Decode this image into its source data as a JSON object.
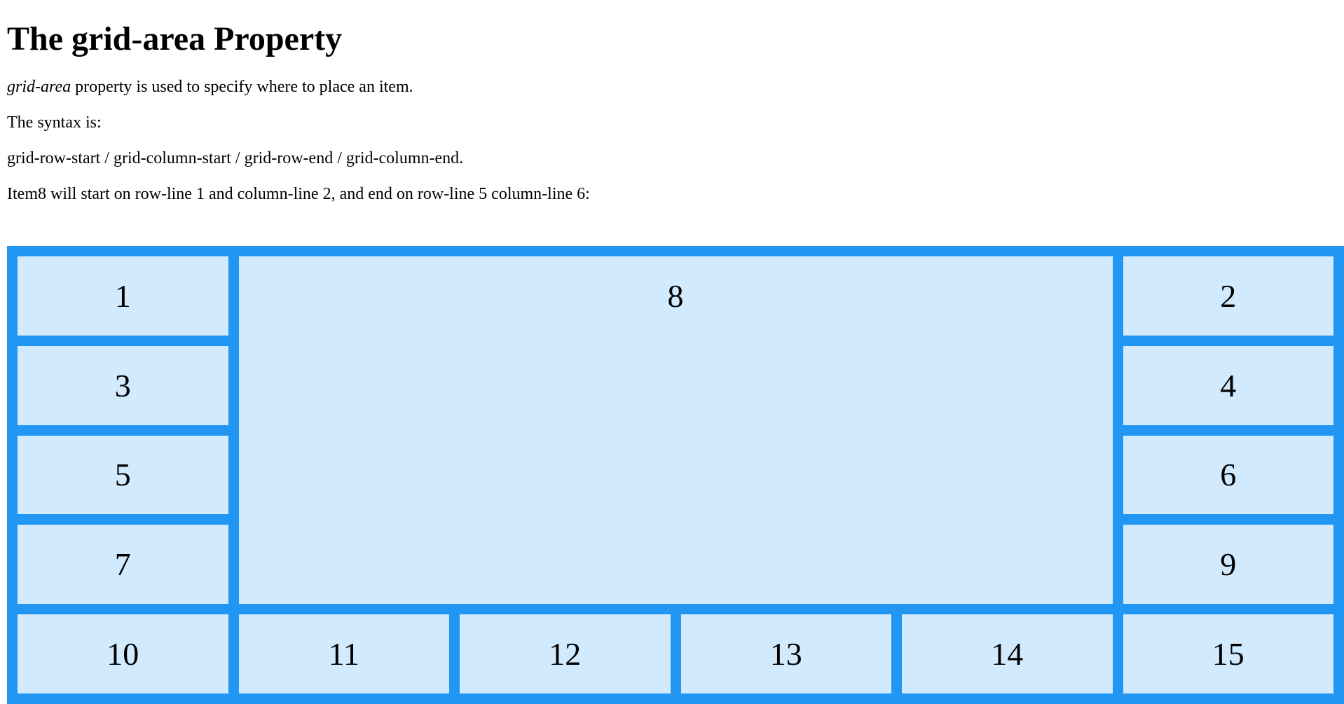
{
  "heading": "The grid-area Property",
  "paragraphs": {
    "intro_em": "grid-area",
    "intro_rest": " property is used to specify where to place an item.",
    "syntax_label": "The syntax is:",
    "syntax": "grid-row-start / grid-column-start / grid-row-end / grid-column-end.",
    "description": "Item8 will start on row-line 1 and column-line 2, and end on row-line 5 column-line 6:"
  },
  "grid": {
    "item1": "1",
    "item2": "2",
    "item3": "3",
    "item4": "4",
    "item5": "5",
    "item6": "6",
    "item7": "7",
    "item8": "8",
    "item9": "9",
    "item10": "10",
    "item11": "11",
    "item12": "12",
    "item13": "13",
    "item14": "14",
    "item15": "15"
  },
  "colors": {
    "grid_background": "#2196F3",
    "item_background": "rgba(255,255,255,0.8)"
  }
}
